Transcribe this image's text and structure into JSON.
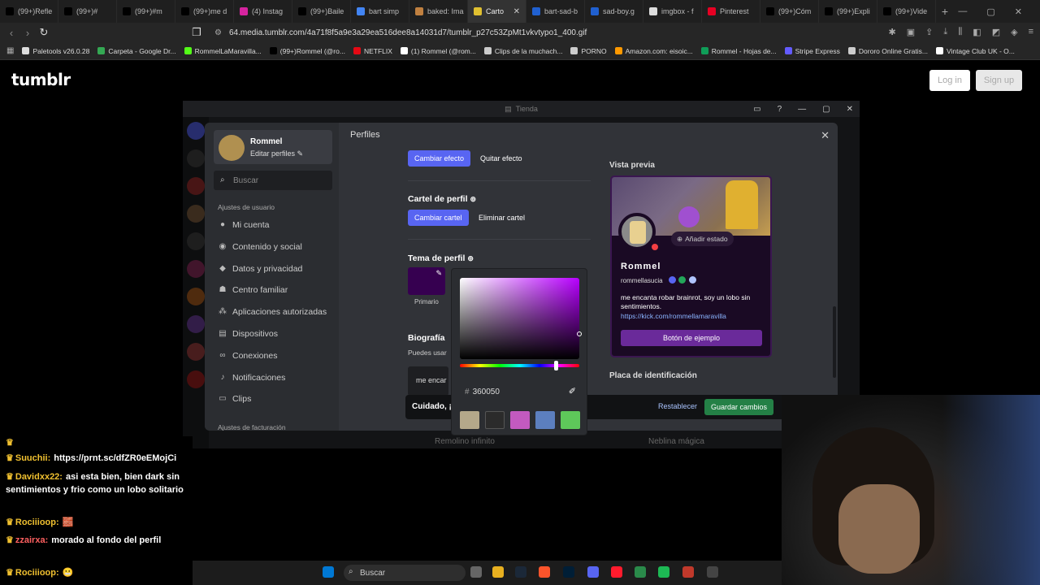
{
  "browser": {
    "tabs": [
      {
        "label": "(99+)Refle",
        "color": "#000"
      },
      {
        "label": "(99+)#",
        "color": "#000"
      },
      {
        "label": "(99+)#m",
        "color": "#000"
      },
      {
        "label": "(99+)me d",
        "color": "#000"
      },
      {
        "label": "(4) Instag",
        "color": "#d6249f"
      },
      {
        "label": "(99+)Baile",
        "color": "#000"
      },
      {
        "label": "bart simp",
        "color": "#4285f4"
      },
      {
        "label": "baked: Ima",
        "color": "#c08040"
      },
      {
        "label": "Carto",
        "color": "#e0c030",
        "active": true
      },
      {
        "label": "bart-sad-b",
        "color": "#2060d0"
      },
      {
        "label": "sad-boy.g",
        "color": "#2060d0"
      },
      {
        "label": "imgbox - f",
        "color": "#ddd"
      },
      {
        "label": "Pinterest",
        "color": "#e60023"
      },
      {
        "label": "(99+)Cóm",
        "color": "#000"
      },
      {
        "label": "(99+)Expli",
        "color": "#000"
      },
      {
        "label": "(99+)Vide",
        "color": "#000"
      }
    ],
    "url": "64.media.tumblr.com/4a71f8f5a9e3a29ea516dee8a14031d7/tumblr_p27c53ZpMt1vkvtypo1_400.gif",
    "bookmarks": [
      {
        "label": "Paletools v26.0.28",
        "color": "#ddd"
      },
      {
        "label": "Carpeta - Google Dr...",
        "color": "#34a853"
      },
      {
        "label": "RommelLaMaravilla...",
        "color": "#53fc18"
      },
      {
        "label": "(99+)Rommel (@ro...",
        "color": "#000"
      },
      {
        "label": "NETFLIX",
        "color": "#e50914"
      },
      {
        "label": "(1) Rommel (@rom...",
        "color": "#fff"
      },
      {
        "label": "Clips de la muchach...",
        "color": "#ccc"
      },
      {
        "label": "PORNO",
        "color": "#ccc"
      },
      {
        "label": "Amazon.com: eisoic...",
        "color": "#ff9900"
      },
      {
        "label": "Rommel - Hojas de...",
        "color": "#0f9d58"
      },
      {
        "label": "Stripe Express",
        "color": "#635bff"
      },
      {
        "label": "Dororo Online Gratis...",
        "color": "#ccc"
      },
      {
        "label": "Vintage Club UK - O...",
        "color": "#fff"
      }
    ]
  },
  "tumblr": {
    "logo": "tumblr",
    "login": "Log in",
    "signup": "Sign up"
  },
  "discord": {
    "window_title": "Tienda",
    "user": {
      "name": "Rommel",
      "edit": "Editar perfiles ✎"
    },
    "search_placeholder": "Buscar",
    "section_user": "Ajustes de usuario",
    "menu": [
      {
        "label": "Mi cuenta",
        "icon": "person-icon"
      },
      {
        "label": "Contenido y social",
        "icon": "chat-icon"
      },
      {
        "label": "Datos y privacidad",
        "icon": "shield-icon"
      },
      {
        "label": "Centro familiar",
        "icon": "family-icon"
      },
      {
        "label": "Aplicaciones autorizadas",
        "icon": "apps-icon"
      },
      {
        "label": "Dispositivos",
        "icon": "devices-icon"
      },
      {
        "label": "Conexiones",
        "icon": "link-icon"
      },
      {
        "label": "Notificaciones",
        "icon": "bell-icon"
      },
      {
        "label": "Clips",
        "icon": "clips-icon"
      }
    ],
    "section_billing": "Ajustes de facturación",
    "page_title": "Perfiles",
    "effect": {
      "change": "Cambiar efecto",
      "remove": "Quitar efecto"
    },
    "banner": {
      "title": "Cartel de perfil",
      "change": "Cambiar cartel",
      "remove": "Eliminar cartel"
    },
    "theme": {
      "title": "Tema de perfil",
      "primary_label": "Primario",
      "primary_color": "#360050"
    },
    "bio": {
      "title": "Biografía",
      "hint": "Puedes usar",
      "value": "me encar"
    },
    "warning": {
      "text": "Cuidado, ¡t",
      "reset": "Restablecer",
      "save": "Guardar cambios"
    },
    "preview": {
      "title": "Vista previa",
      "add_status": "Añadir estado",
      "display_name": "Rommel",
      "username": "rommellasucia",
      "bio": "me encanta robar brainrot, soy un lobo sin sentimientos.",
      "link": "https://kick.com/rommellamaravilla",
      "button": "Botón de ejemplo"
    },
    "nameplate_title": "Placa de identificación",
    "color_picker": {
      "hex": "360050",
      "hue_fraction": 0.8,
      "swatches": [
        "#b4a88a",
        "#2b2b2b",
        "#c35abf",
        "#5c7fbf",
        "#5ec85a"
      ]
    },
    "bottom_labels": [
      "Remolino infinito",
      "Neblina mágica"
    ]
  },
  "chat": [
    {
      "user": "",
      "msg": ""
    },
    {
      "user": "Suuchii:",
      "msg": "https://prnt.sc/dfZR0eEMojCi"
    },
    {
      "user": "Davidxx22:",
      "msg": "asi esta bien, bien dark sin sentimientos y frio como un lobo solitario"
    },
    {
      "user": "Rociiioop:",
      "msg": "🧱"
    },
    {
      "user": "zzairxa:",
      "msg": "morado al fondo del perfil"
    },
    {
      "user": "Rociiioop:",
      "msg": "😬"
    }
  ],
  "taskbar": {
    "search": "Buscar"
  }
}
